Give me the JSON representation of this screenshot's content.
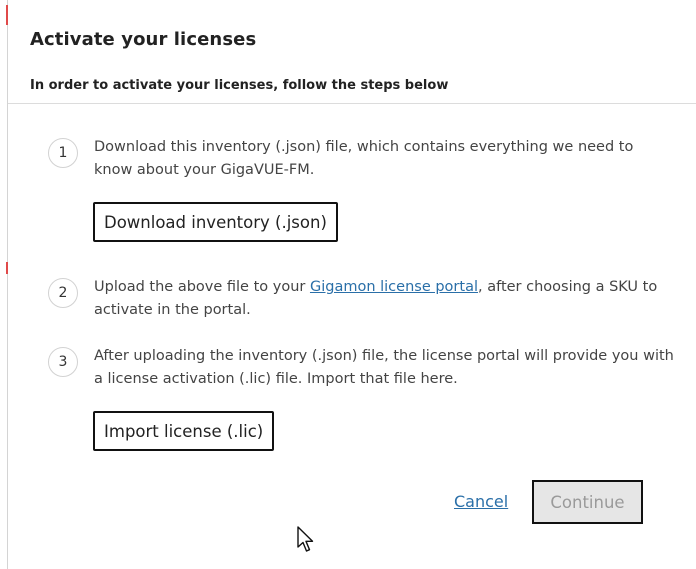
{
  "dialog": {
    "title": "Activate your licenses",
    "subtitle": "In order to activate your licenses, follow the steps below"
  },
  "steps": [
    {
      "number": "1",
      "text": "Download this inventory (.json) file, which contains everything we need to know about your GigaVUE-FM.",
      "button_label": "Download inventory (.json)"
    },
    {
      "number": "2",
      "text_before_link": "Upload the above file to your ",
      "link_text": "Gigamon license portal",
      "text_after_link": ", after choosing a SKU to activate in the portal."
    },
    {
      "number": "3",
      "text": "After uploading the inventory (.json) file, the license portal will provide you with a license activation (.lic) file. Import that file here.",
      "button_label": "Import license (.lic)"
    }
  ],
  "footer": {
    "cancel_label": "Cancel",
    "continue_label": "Continue"
  },
  "colors": {
    "link": "#2a6fa8",
    "continue_disabled_bg": "#e6e6e6",
    "continue_disabled_text": "#9a9a9a"
  },
  "icons": {
    "cursor": "mouse-pointer-icon"
  }
}
